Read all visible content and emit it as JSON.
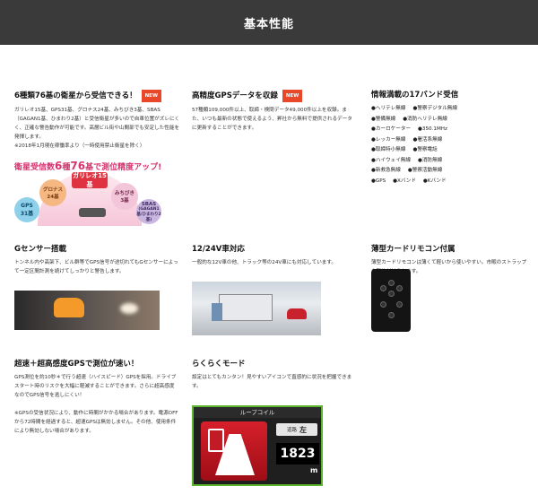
{
  "header": {
    "title": "基本性能"
  },
  "sections": {
    "satellite": {
      "title": "6種類76基の衛星から受信できる！",
      "badge": "NEW",
      "body": "ガリレオ15基、GPS31基、グロナス24基、みちびき3基、SBAS（GAGAN1基、ひまわり2基）と受信衛星が多いので自車位置がズレにくく、正確な警告動作が可能です。高層ビル街や山間部でも安定した性能を発揮します。",
      "note": "※2018年1月現在稼働率より（一時使用禁止衛星を除く）",
      "headline_pre": "衛星受信数",
      "headline_num1": "6",
      "headline_mid": "種",
      "headline_num2": "76",
      "headline_post": "基で測位精度アップ!",
      "galileo": "ガリレオ15基",
      "gps_name": "GPS",
      "gps_count": "31基",
      "glonass_name": "グロナス",
      "glonass_count": "24基",
      "michibiki_name": "みちびき",
      "michibiki_count": "3基",
      "sbas_name": "SBAS",
      "sbas_detail": "(GAGAN1基/ひまわり2基)"
    },
    "gps_data": {
      "title": "高精度GPSデータを収録",
      "badge": "NEW",
      "body": "57種類109,000件以上、取締・検問データ49,000件以上を収録。また、いつも最新の状態で使えるよう、昇社から無料で提供されるデータに更新することができます。"
    },
    "bands": {
      "title": "情報満載の17バンド受信",
      "rows": [
        [
          "●ヘリテレ無線",
          "●警察デジタル無線"
        ],
        [
          "●警備無線",
          "●消防ヘリテレ無線"
        ],
        [
          "●カーロケーター",
          "●350.1MHz"
        ],
        [
          "●レッカー無線",
          "●署活系無線"
        ],
        [
          "●取締特小無線",
          "●警察電話"
        ],
        [
          "●ハイウェイ無線",
          "●消防無線"
        ],
        [
          "●新救急無線",
          "●警察活動無線"
        ],
        [
          "●GPS",
          "●Xバンド",
          "●Kバンド"
        ]
      ]
    },
    "gsensor": {
      "title": "Gセンサー搭載",
      "body": "トンネル内や高架下、ビル群等でGPS信号が途切れてもGセンサーによって一定区間計測を続けてしっかりと警告します。"
    },
    "power": {
      "title": "12/24V車対応",
      "body": "一般的な12V車の他、トラック等の24V車にも対応しています。"
    },
    "remote": {
      "title": "薄型カードリモコン付属",
      "body": "薄型カードリモコンは薄くて軽いから使いやすい。市販のストラップを取り付けられます。"
    },
    "fast": {
      "title": "超速＋超高感度GPSで測位が速い！",
      "body": "GPS測位を約10秒＊で行う超速（ハイスピード）GPSを採用。ドライブスタート時のリスクを大幅に軽減することができます。さらに超高感度なのでGPS信号を逃しにくい！",
      "note": "※GPSの受信状況により、動作に時間がかかる場合があります。電源OFFから72時間を経過すると、超速GPSは無効しません。その他、使用条件により無効しない場合があります。"
    },
    "easy": {
      "title": "らくらくモード",
      "body": "設定はとてもカンタン！見やすいアイコンで直感的に状況を把握できます。",
      "display_title": "ループコイル",
      "sign_label": "道路",
      "sign_side": "左",
      "distance": "1823",
      "unit": "m"
    }
  }
}
